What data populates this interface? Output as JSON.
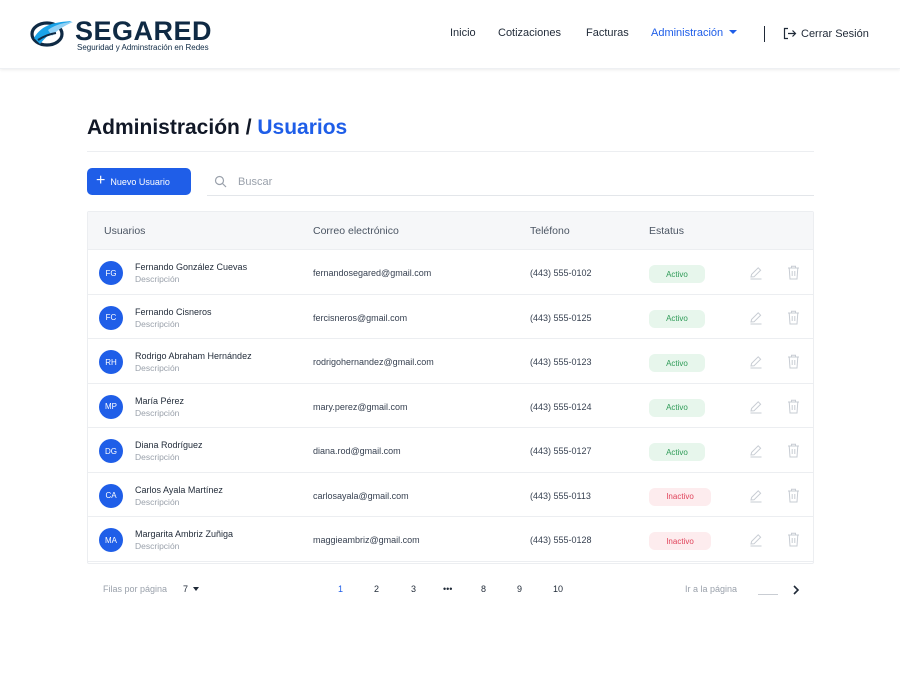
{
  "brand": {
    "name": "SEGARED",
    "tagline": "Seguridad y Adminstración en Redes",
    "colors": {
      "primary": "#1f5ee8",
      "navy": "#0f2a44",
      "active_green": "#2e9b57",
      "inactive_red": "#e0445b"
    }
  },
  "nav": {
    "items": [
      {
        "label": "Inicio"
      },
      {
        "label": "Cotizaciones"
      },
      {
        "label": "Facturas"
      },
      {
        "label": "Administración",
        "active": true,
        "has_dropdown": true
      }
    ],
    "logout_label": "Cerrar Sesión",
    "logout_icon": "logout-icon"
  },
  "page": {
    "section": "Administración",
    "separator": " / ",
    "current": "Usuarios"
  },
  "toolbar": {
    "new_user_label": "Nuevo Usuario",
    "search_placeholder": "Buscar",
    "search_value": ""
  },
  "table": {
    "columns": [
      "Usuarios",
      "Correo electrónico",
      "Teléfono",
      "Estatus"
    ],
    "rows": [
      {
        "initials": "FG",
        "name": "Fernando González Cuevas",
        "description": "Descripción",
        "email": "fernandosegared@gmail.com",
        "phone": "(443) 555-0102",
        "status": "Activo",
        "active": true
      },
      {
        "initials": "FC",
        "name": "Fernando Cisneros",
        "description": "Descripción",
        "email": "fercisneros@gmail.com",
        "phone": "(443) 555-0125",
        "status": "Activo",
        "active": true
      },
      {
        "initials": "RH",
        "name": "Rodrigo Abraham Hernández",
        "description": "Descripción",
        "email": "rodrigohernandez@gmail.com",
        "phone": "(443) 555-0123",
        "status": "Activo",
        "active": true
      },
      {
        "initials": "MP",
        "name": "María Pérez",
        "description": "Descripción",
        "email": "mary.perez@gmail.com",
        "phone": "(443) 555-0124",
        "status": "Activo",
        "active": true
      },
      {
        "initials": "DG",
        "name": "Diana Rodríguez",
        "description": "Descripción",
        "email": "diana.rod@gmail.com",
        "phone": "(443) 555-0127",
        "status": "Activo",
        "active": true
      },
      {
        "initials": "CA",
        "name": "Carlos Ayala Martínez",
        "description": "Descripción",
        "email": "carlosayala@gmail.com",
        "phone": "(443) 555-0113",
        "status": "Inactivo",
        "active": false
      },
      {
        "initials": "MA",
        "name": "Margarita Ambriz Zuñiga",
        "description": "Descripción",
        "email": "maggieambriz@gmail.com",
        "phone": "(443) 555-0128",
        "status": "Inactivo",
        "active": false
      }
    ],
    "row_actions": [
      "edit-icon",
      "trash-icon"
    ]
  },
  "pagination": {
    "rows_per_page_label": "Filas por página",
    "rows_per_page_value": "7",
    "pages": [
      "1",
      "2",
      "3",
      "•••",
      "8",
      "9",
      "10"
    ],
    "current_page": "1",
    "goto_label": "Ir a la página",
    "goto_value": ""
  }
}
